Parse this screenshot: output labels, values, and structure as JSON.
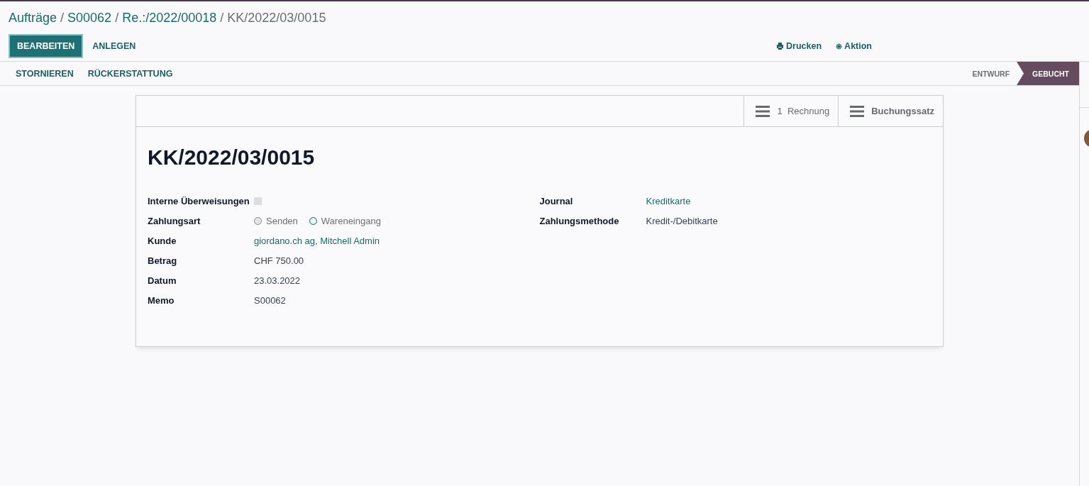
{
  "breadcrumb": [
    {
      "label": "Aufträge",
      "current": false
    },
    {
      "label": "S00062",
      "current": false
    },
    {
      "label": "Re.:/2022/00018",
      "current": false
    },
    {
      "label": "KK/2022/03/0015",
      "current": true
    }
  ],
  "breadcrumb_separator": "/",
  "buttons": [
    {
      "label": "BEARBEITEN",
      "kind": "primary"
    },
    {
      "label": "ANLEGEN",
      "kind": "secondary"
    }
  ],
  "actions": [
    {
      "label": "Drucken",
      "kind": "print"
    },
    {
      "label": "Aktion",
      "kind": "gear"
    }
  ],
  "header_buttons": [
    "STORNIEREN",
    "RÜCKERSTATTUNG"
  ],
  "stages": [
    {
      "label": "ENTWURF",
      "selected": false
    },
    {
      "label": "GEBUCHT",
      "selected": true
    }
  ],
  "smart_buttons": [
    {
      "count": "1",
      "label": "Rechnung"
    },
    {
      "label": "Buchungssatz"
    }
  ],
  "title": "KK/2022/03/0015",
  "left_fields": [
    {
      "label": "Interne Überweisungen",
      "kind": "checkbox",
      "checked": false
    },
    {
      "label": "Zahlungsart",
      "kind": "radio",
      "options": [
        {
          "label": "Senden",
          "selected": false
        },
        {
          "label": "Wareneingang",
          "selected": true
        }
      ]
    },
    {
      "label": "Kunde",
      "kind": "link",
      "value": "giordano.ch ag, Mitchell Admin"
    },
    {
      "label": "Betrag",
      "kind": "text",
      "value": "CHF 750.00"
    },
    {
      "label": "Datum",
      "kind": "text",
      "value": "23.03.2022"
    },
    {
      "label": "Memo",
      "kind": "text",
      "value": "S00062"
    }
  ],
  "right_fields": [
    {
      "label": "Journal",
      "kind": "link",
      "value": "Kreditkarte"
    },
    {
      "label": "Zahlungsmethode",
      "kind": "text",
      "value": "Kredit-/Debitkarte"
    }
  ]
}
